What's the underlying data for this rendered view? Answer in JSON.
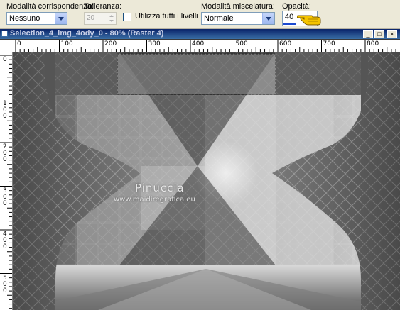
{
  "toolbar": {
    "match_mode": {
      "label": "Modalità corrispondenza:",
      "value": "Nessuno"
    },
    "tolerance": {
      "label": "Tolleranza:",
      "value": "20"
    },
    "use_all_layers": {
      "label": "Utilizza tutti i livelli",
      "checked": false
    },
    "blend_mode": {
      "label": "Modalità miscelatura:",
      "value": "Normale"
    },
    "opacity": {
      "label": "Opacità:",
      "value": "40",
      "fraction": 0.4
    }
  },
  "document": {
    "title": "Selection_4_img_4ody_0 - 80% (Raster 4)",
    "ruler_top_labels": [
      "0",
      "100",
      "200",
      "300",
      "400",
      "500",
      "600",
      "700",
      "800"
    ],
    "ruler_left_labels": [
      "0",
      "1\n0\n0",
      "2\n0\n0",
      "3\n0\n0",
      "4\n0\n0",
      "5\n0\n0"
    ]
  },
  "watermark": {
    "name": "Pinuccia",
    "site": "www.maidiregrafica.eu"
  },
  "colors": {
    "toolbar_bg": "#ece9d8",
    "field_border": "#7f9db9",
    "opacity_bar": "#1c4ad0",
    "cursor_hand": "#f5c400"
  }
}
